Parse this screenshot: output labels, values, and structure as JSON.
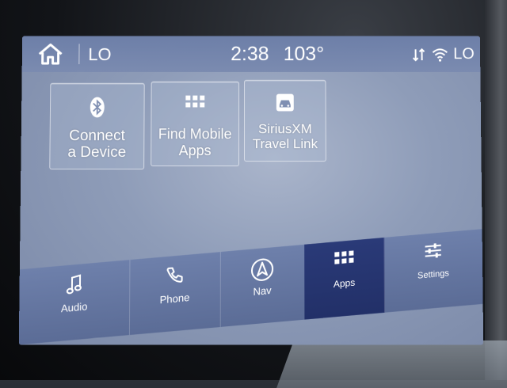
{
  "status_bar": {
    "home_icon": "home-icon",
    "temp_left": "LO",
    "time": "2:38",
    "outside_temp": "103°",
    "icons": [
      "data-arrows-icon",
      "wifi-icon"
    ],
    "temp_right": "LO"
  },
  "tiles": [
    {
      "label": "Connect\na Device",
      "icon": "bluetooth-icon"
    },
    {
      "label": "Find Mobile\nApps",
      "icon": "app-grid-icon"
    },
    {
      "label": "SiriusXM\nTravel Link",
      "icon": "car-icon"
    }
  ],
  "nav": {
    "items": [
      {
        "label": "Audio",
        "icon": "music-note-icon"
      },
      {
        "label": "Phone",
        "icon": "phone-icon"
      },
      {
        "label": "Nav",
        "icon": "navigation-arrow-icon"
      },
      {
        "label": "Apps",
        "icon": "app-grid-icon",
        "active": true
      },
      {
        "label": "Settings",
        "icon": "sliders-icon"
      }
    ]
  },
  "colors": {
    "screen_bg": "#8e9cb8",
    "active_tab": "#2a3a78",
    "text": "#ffffff"
  }
}
